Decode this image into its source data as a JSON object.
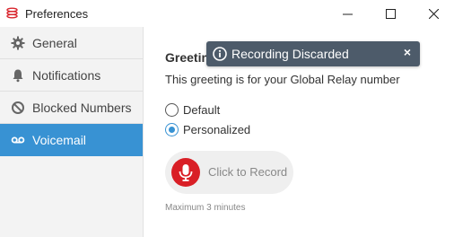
{
  "window": {
    "title": "Preferences",
    "controls": [
      "minimize",
      "maximize",
      "close"
    ]
  },
  "sidebar": {
    "items": [
      {
        "label": "General",
        "icon": "gear-icon",
        "active": false
      },
      {
        "label": "Notifications",
        "icon": "bell-icon",
        "active": false
      },
      {
        "label": "Blocked Numbers",
        "icon": "blocked-icon",
        "active": false
      },
      {
        "label": "Voicemail",
        "icon": "voicemail-icon",
        "active": true
      }
    ]
  },
  "main": {
    "section_title": "Greetin",
    "description": "This greeting is for your Global Relay number",
    "options": [
      {
        "label": "Default",
        "selected": false
      },
      {
        "label": "Personalized",
        "selected": true
      }
    ],
    "record_button_label": "Click to Record",
    "hint": "Maximum 3 minutes"
  },
  "toast": {
    "message": "Recording Discarded",
    "close_glyph": "×",
    "icon": "info-icon"
  },
  "colors": {
    "accent": "#3892d3",
    "toast_bg": "#4d5b6a",
    "mic_red": "#d91f26",
    "sidebar_bg": "#f3f3f3"
  }
}
